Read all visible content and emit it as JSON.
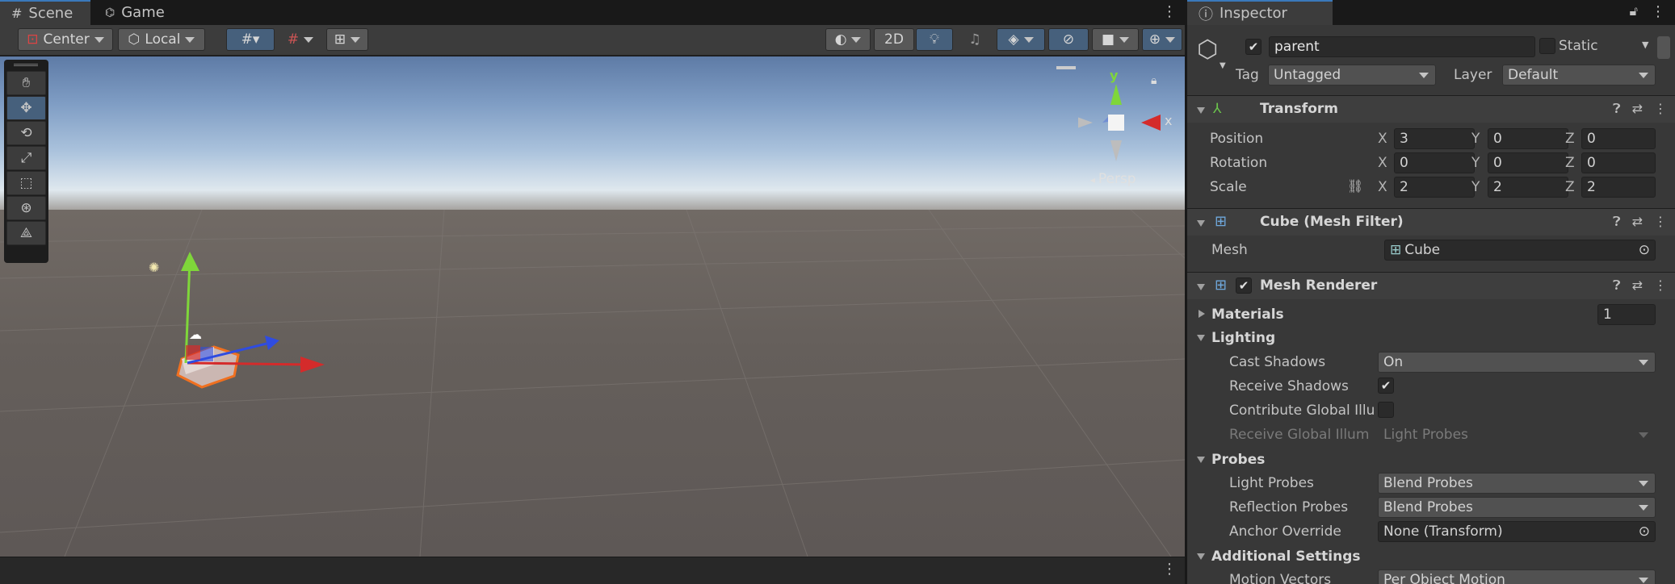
{
  "tabs": {
    "scene": "Scene",
    "game": "Game",
    "inspector": "Inspector"
  },
  "toolbar": {
    "pivot": "Center",
    "space": "Local",
    "mode2d": "2D"
  },
  "scene": {
    "gizmo_y": "y",
    "gizmo_x": "x",
    "persp": "Persp"
  },
  "inspector": {
    "object_name": "parent",
    "static_label": "Static",
    "tag_label": "Tag",
    "tag_value": "Untagged",
    "layer_label": "Layer",
    "layer_value": "Default",
    "transform": {
      "title": "Transform",
      "position_label": "Position",
      "rotation_label": "Rotation",
      "scale_label": "Scale",
      "position": {
        "x": "3",
        "y": "0",
        "z": "0"
      },
      "rotation": {
        "x": "0",
        "y": "0",
        "z": "0"
      },
      "scale": {
        "x": "2",
        "y": "2",
        "z": "2"
      },
      "ax": "X",
      "ay": "Y",
      "az": "Z"
    },
    "mesh_filter": {
      "title": "Cube (Mesh Filter)",
      "mesh_label": "Mesh",
      "mesh_value": "Cube"
    },
    "mesh_renderer": {
      "title": "Mesh Renderer",
      "materials_label": "Materials",
      "materials_count": "1",
      "lighting_label": "Lighting",
      "cast_shadows_label": "Cast Shadows",
      "cast_shadows_value": "On",
      "receive_shadows_label": "Receive Shadows",
      "contribute_gi_label": "Contribute Global Illu",
      "receive_gi_label": "Receive Global Illum",
      "receive_gi_value": "Light Probes",
      "probes_label": "Probes",
      "light_probes_label": "Light Probes",
      "light_probes_value": "Blend Probes",
      "reflection_probes_label": "Reflection Probes",
      "reflection_probes_value": "Blend Probes",
      "anchor_label": "Anchor Override",
      "anchor_value": "None (Transform)",
      "additional_label": "Additional Settings",
      "motion_label": "Motion Vectors",
      "motion_value": "Per Object Motion"
    }
  },
  "colors": {
    "accent": "#3a79bb",
    "x_axis": "#d42b2b",
    "y_axis": "#7fd63a",
    "z_axis": "#2f4ce0",
    "selection": "#f07020"
  }
}
